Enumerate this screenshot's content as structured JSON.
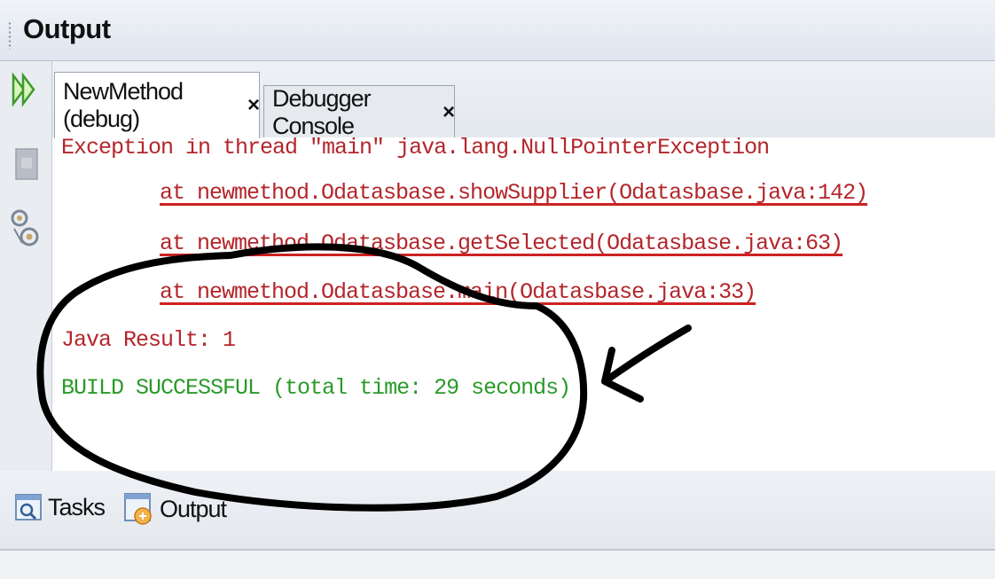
{
  "window": {
    "title": "Output"
  },
  "sidebar": {
    "icons": [
      "rerun-icon",
      "stop-icon",
      "settings-icon"
    ]
  },
  "tabs": [
    {
      "label": "NewMethod (debug)",
      "close": "×",
      "active": true
    },
    {
      "label": "Debugger Console",
      "close": "×",
      "active": false
    }
  ],
  "console": {
    "lines": [
      {
        "text": "Exception in thread \"main\" java.lang.NullPointerException",
        "kind": "error"
      },
      {
        "text": "at newmethod.Odatasbase.showSupplier(Odatasbase.java:142)",
        "kind": "error-link"
      },
      {
        "text": "at newmethod.Odatasbase.getSelected(Odatasbase.java:63)",
        "kind": "error-link"
      },
      {
        "text": "at newmethod.Odatasbase.main(Odatasbase.java:33)",
        "kind": "error-link"
      },
      {
        "text": "Java Result: 1",
        "kind": "error"
      },
      {
        "text": "BUILD SUCCESSFUL (total time: 29 seconds)",
        "kind": "success"
      }
    ]
  },
  "bottom_tabs": [
    {
      "label": "Tasks",
      "icon": "tasks-icon"
    },
    {
      "label": "Output",
      "icon": "output-icon"
    }
  ],
  "colors": {
    "error": "#b3262b",
    "success": "#2a9a2a",
    "annotation": "#000000"
  }
}
